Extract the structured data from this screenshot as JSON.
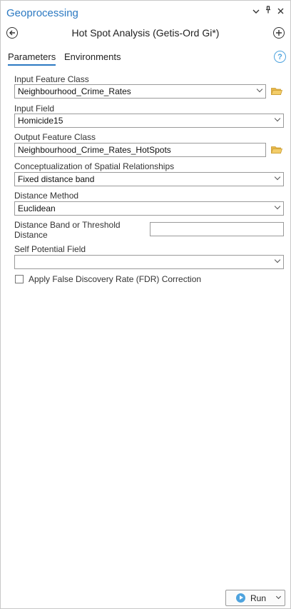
{
  "pane": {
    "title": "Geoprocessing",
    "pin_icon": "pin-icon",
    "options_icon": "chevron-down-icon",
    "close_icon": "close-icon"
  },
  "tool": {
    "title": "Hot Spot Analysis (Getis-Ord Gi*)",
    "back_icon": "back-arrow-icon",
    "add_icon": "plus-icon"
  },
  "tabs": [
    {
      "label": "Parameters",
      "active": true
    },
    {
      "label": "Environments",
      "active": false
    }
  ],
  "help_icon": "help-icon",
  "help_glyph": "?",
  "params": {
    "input_feature_class": {
      "label": "Input Feature Class",
      "value": "Neighbourhood_Crime_Rates"
    },
    "input_field": {
      "label": "Input Field",
      "value": "Homicide15"
    },
    "output_feature_class": {
      "label": "Output Feature Class",
      "value": "Neighbourhood_Crime_Rates_HotSpots"
    },
    "conceptualization": {
      "label": "Conceptualization of Spatial Relationships",
      "value": "Fixed distance band"
    },
    "distance_method": {
      "label": "Distance Method",
      "value": "Euclidean"
    },
    "distance_band": {
      "label_line1": "Distance Band or Threshold",
      "label_line2": "Distance",
      "value": ""
    },
    "self_potential": {
      "label": "Self Potential Field",
      "value": ""
    },
    "fdr": {
      "label": "Apply False Discovery Rate (FDR) Correction",
      "checked": false
    }
  },
  "run_button": {
    "label": "Run"
  },
  "colors": {
    "accent": "#2b79c2",
    "help": "#4ea3de",
    "folder": "#e8b84a"
  }
}
